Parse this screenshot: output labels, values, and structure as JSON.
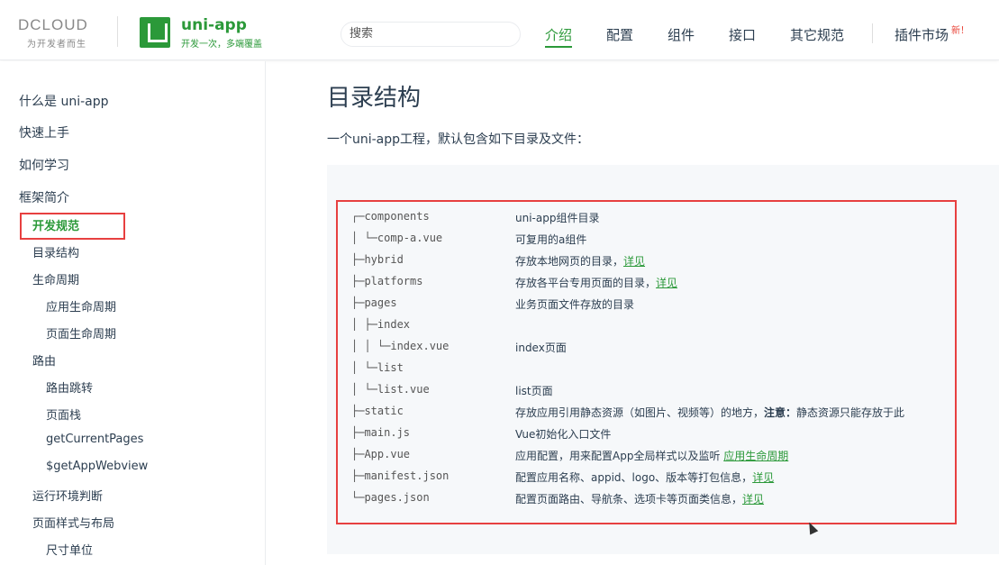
{
  "header": {
    "dcloud_logo": "DCLOUD",
    "dcloud_slogan": "为开发者而生",
    "app_title": "uni-app",
    "app_subtitle": "开发一次，多端覆盖",
    "search_placeholder": "搜索",
    "nav": [
      {
        "label": "介绍",
        "active": true
      },
      {
        "label": "配置",
        "active": false
      },
      {
        "label": "组件",
        "active": false
      },
      {
        "label": "接口",
        "active": false
      },
      {
        "label": "其它规范",
        "active": false
      },
      {
        "label": "插件市场",
        "active": false
      }
    ],
    "new_badge": "新！",
    "brand_color": "#2b9939",
    "highlight_color": "#e74040"
  },
  "sidebar": {
    "items": [
      {
        "label": "什么是 uni-app",
        "level": 1
      },
      {
        "label": "快速上手",
        "level": 1
      },
      {
        "label": "如何学习",
        "level": 1
      },
      {
        "label": "框架简介",
        "level": 1
      },
      {
        "label": "开发规范",
        "level": 2,
        "active": true
      },
      {
        "label": "目录结构",
        "level": 2
      },
      {
        "label": "生命周期",
        "level": 2
      },
      {
        "label": "应用生命周期",
        "level": 3
      },
      {
        "label": "页面生命周期",
        "level": 3
      },
      {
        "label": "路由",
        "level": 2
      },
      {
        "label": "路由跳转",
        "level": 3
      },
      {
        "label": "页面栈",
        "level": 3
      },
      {
        "label": "getCurrentPages",
        "level": 3
      },
      {
        "label": "$getAppWebview",
        "level": 3
      },
      {
        "label": "运行环境判断",
        "level": 2
      },
      {
        "label": "页面样式与布局",
        "level": 2
      },
      {
        "label": "尺寸单位",
        "level": 3
      }
    ]
  },
  "main": {
    "title": "目录结构",
    "intro": "一个uni-app工程，默认包含如下目录及文件：",
    "tree": [
      {
        "tree": "┌─components",
        "desc": "uni-app组件目录",
        "link": ""
      },
      {
        "tree": "│  └─comp-a.vue",
        "desc": "可复用的a组件",
        "link": ""
      },
      {
        "tree": "├─hybrid",
        "desc": "存放本地网页的目录，",
        "link": "详见"
      },
      {
        "tree": "├─platforms",
        "desc": "存放各平台专用页面的目录，",
        "link": "详见"
      },
      {
        "tree": "├─pages",
        "desc": "业务页面文件存放的目录",
        "link": ""
      },
      {
        "tree": "│  ├─index",
        "desc": "",
        "link": ""
      },
      {
        "tree": "│  │  └─index.vue",
        "desc": "index页面",
        "link": ""
      },
      {
        "tree": "│  └─list",
        "desc": "",
        "link": ""
      },
      {
        "tree": "│     └─list.vue",
        "desc": "list页面",
        "link": ""
      },
      {
        "tree": "├─static",
        "desc": "存放应用引用静态资源（如图片、视频等）的地方，",
        "strong": "注意：",
        "desc2": "静态资源只能存放于此",
        "link": ""
      },
      {
        "tree": "├─main.js",
        "desc": "Vue初始化入口文件",
        "link": ""
      },
      {
        "tree": "├─App.vue",
        "desc": "应用配置，用来配置App全局样式以及监听 ",
        "link": "应用生命周期"
      },
      {
        "tree": "├─manifest.json",
        "desc": "配置应用名称、appid、logo、版本等打包信息，",
        "link": "详见"
      },
      {
        "tree": "└─pages.json",
        "desc": "配置页面路由、导航条、选项卡等页面类信息，",
        "link": "详见"
      }
    ]
  }
}
